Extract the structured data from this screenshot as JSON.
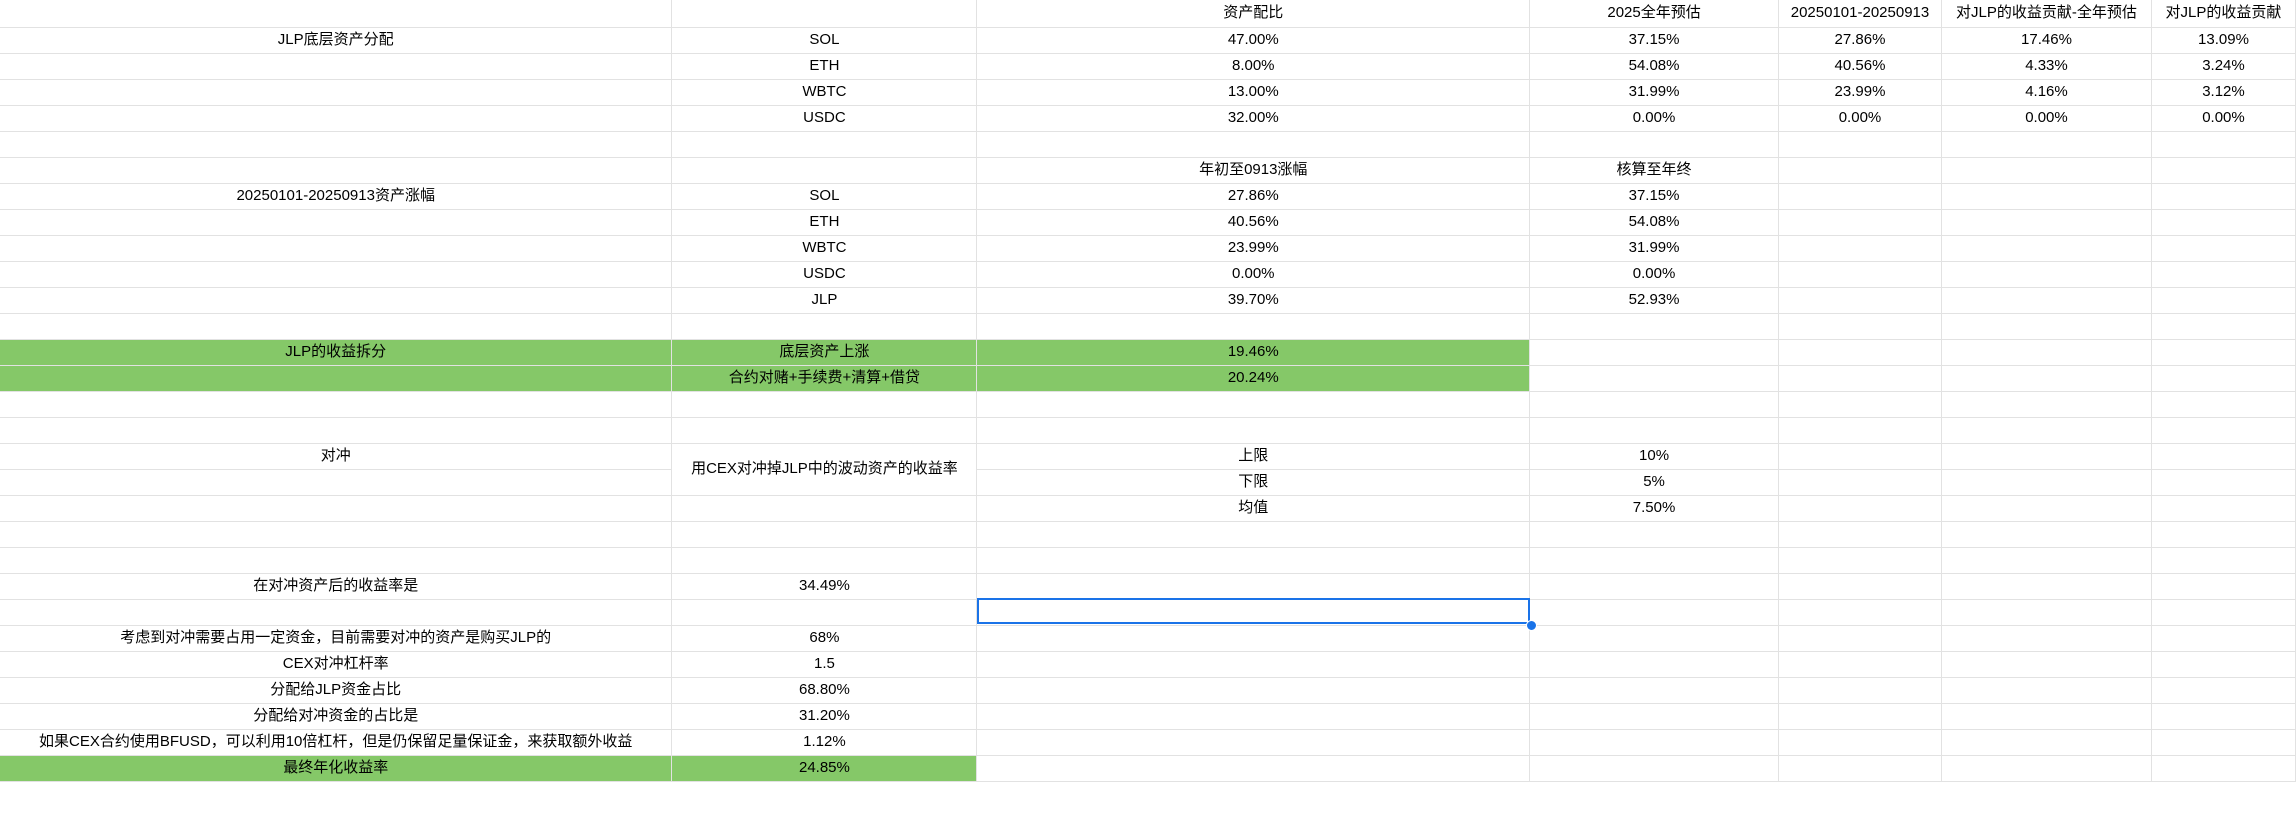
{
  "sheet": {
    "rows": [
      [
        "",
        "",
        "资产配比",
        "2025全年预估",
        "20250101-20250913",
        "对JLP的收益贡献-全年预估",
        "对JLP的收益贡献"
      ],
      [
        "JLP底层资产分配",
        "SOL",
        "47.00%",
        "37.15%",
        "27.86%",
        "17.46%",
        "13.09%"
      ],
      [
        "",
        "ETH",
        "8.00%",
        "54.08%",
        "40.56%",
        "4.33%",
        "3.24%"
      ],
      [
        "",
        "WBTC",
        "13.00%",
        "31.99%",
        "23.99%",
        "4.16%",
        "3.12%"
      ],
      [
        "",
        "USDC",
        "32.00%",
        "0.00%",
        "0.00%",
        "0.00%",
        "0.00%"
      ],
      [
        "",
        "",
        "",
        "",
        "",
        "",
        ""
      ],
      [
        "",
        "",
        "年初至0913涨幅",
        "核算至年终",
        "",
        "",
        ""
      ],
      [
        "20250101-20250913资产涨幅",
        "SOL",
        "27.86%",
        "37.15%",
        "",
        "",
        ""
      ],
      [
        "",
        "ETH",
        "40.56%",
        "54.08%",
        "",
        "",
        ""
      ],
      [
        "",
        "WBTC",
        "23.99%",
        "31.99%",
        "",
        "",
        ""
      ],
      [
        "",
        "USDC",
        "0.00%",
        "0.00%",
        "",
        "",
        ""
      ],
      [
        "",
        "JLP",
        "39.70%",
        "52.93%",
        "",
        "",
        ""
      ],
      [
        "",
        "",
        "",
        "",
        "",
        "",
        ""
      ],
      [
        "JLP的收益拆分",
        "底层资产上涨",
        "19.46%",
        "",
        "",
        "",
        ""
      ],
      [
        "",
        "合约对赌+手续费+清算+借贷",
        "20.24%",
        "",
        "",
        "",
        ""
      ],
      [
        "",
        "",
        "",
        "",
        "",
        "",
        ""
      ],
      [
        "",
        "",
        "",
        "",
        "",
        "",
        ""
      ],
      [
        "对冲",
        "用CEX对冲掉JLP中的波动资产的收益率",
        "上限",
        "10%",
        "",
        "",
        ""
      ],
      [
        "",
        "",
        "下限",
        "5%",
        "",
        "",
        ""
      ],
      [
        "",
        "",
        "均值",
        "7.50%",
        "",
        "",
        ""
      ],
      [
        "",
        "",
        "",
        "",
        "",
        "",
        ""
      ],
      [
        "",
        "",
        "",
        "",
        "",
        "",
        ""
      ],
      [
        "在对冲资产后的收益率是",
        "34.49%",
        "",
        "",
        "",
        "",
        ""
      ],
      [
        "",
        "",
        "",
        "",
        "",
        "",
        ""
      ],
      [
        "考虑到对冲需要占用一定资金，目前需要对冲的资产是购买JLP的",
        "68%",
        "",
        "",
        "",
        "",
        ""
      ],
      [
        "CEX对冲杠杆率",
        "1.5",
        "",
        "",
        "",
        "",
        ""
      ],
      [
        "分配给JLP资金占比",
        "68.80%",
        "",
        "",
        "",
        "",
        ""
      ],
      [
        "分配给对冲资金的占比是",
        "31.20%",
        "",
        "",
        "",
        "",
        ""
      ],
      [
        "如果CEX合约使用BFUSD，可以利用10倍杠杆，但是仍保留足量保证金，来获取额外收益",
        "1.12%",
        "",
        "",
        "",
        "",
        ""
      ],
      [
        "最终年化收益率",
        "24.85%",
        "",
        "",
        "",
        "",
        ""
      ]
    ],
    "fill_colors": {
      "highlight": "#85c868",
      "selection": "#1a73e8"
    }
  }
}
